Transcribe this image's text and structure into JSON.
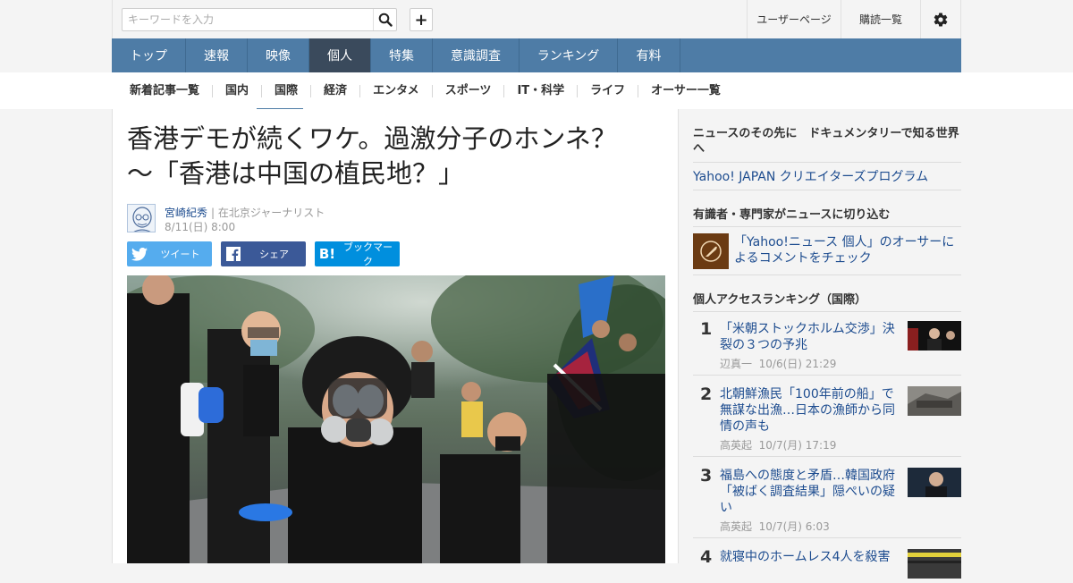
{
  "search": {
    "placeholder": "キーワードを入力"
  },
  "top_links": {
    "user_page": "ユーザーページ",
    "subscriptions": "購読一覧"
  },
  "main_nav": [
    "トップ",
    "速報",
    "映像",
    "個人",
    "特集",
    "意識調査",
    "ランキング",
    "有料"
  ],
  "main_nav_active": "個人",
  "sub_nav": [
    "新着記事一覧",
    "国内",
    "国際",
    "経済",
    "エンタメ",
    "スポーツ",
    "IT・科学",
    "ライフ",
    "オーサー一覧"
  ],
  "sub_nav_active": "国際",
  "article": {
    "title_line1": "香港デモが続くワケ。過激分子のホンネ？",
    "title_line2": "～「香港は中国の植民地？」",
    "author": "宮崎紀秀",
    "author_role": "| 在北京ジャーナリスト",
    "date": "8/11(日) 8:00"
  },
  "share": {
    "tweet": "ツイート",
    "facebook": "シェア",
    "bookmark": "ブックマーク"
  },
  "sidebar": {
    "section1_title": "ニュースのその先に　ドキュメンタリーで知る世界へ",
    "section1_link": "Yahoo! JAPAN クリエイターズプログラム",
    "section2_title": "有識者・専門家がニュースに切り込む",
    "section2_text": "「Yahoo!ニュース 個人」のオーサーによるコメントをチェック",
    "ranking_title": "個人アクセスランキング（国際）",
    "ranking": [
      {
        "rank": "1",
        "title": "「米朝ストックホルム交渉」決裂の３つの予兆",
        "author": "辺真一",
        "date": "10/6(日) 21:29"
      },
      {
        "rank": "2",
        "title": "北朝鮮漁民「100年前の船」で無謀な出漁…日本の漁師から同情の声も",
        "author": "高英起",
        "date": "10/7(月) 17:19"
      },
      {
        "rank": "3",
        "title": "福島への態度と矛盾…韓国政府「被ばく調査結果」隠ぺいの疑い",
        "author": "高英起",
        "date": "10/7(月) 6:03"
      },
      {
        "rank": "4",
        "title": "就寝中のホームレス4人を殺害",
        "author": "",
        "date": ""
      }
    ]
  },
  "colors": {
    "nav": "#4e7ca6",
    "nav_active": "#3a4a5c",
    "link": "#1d4c8f",
    "twitter": "#55acee",
    "facebook": "#3b5998",
    "hatena": "#008fde"
  }
}
